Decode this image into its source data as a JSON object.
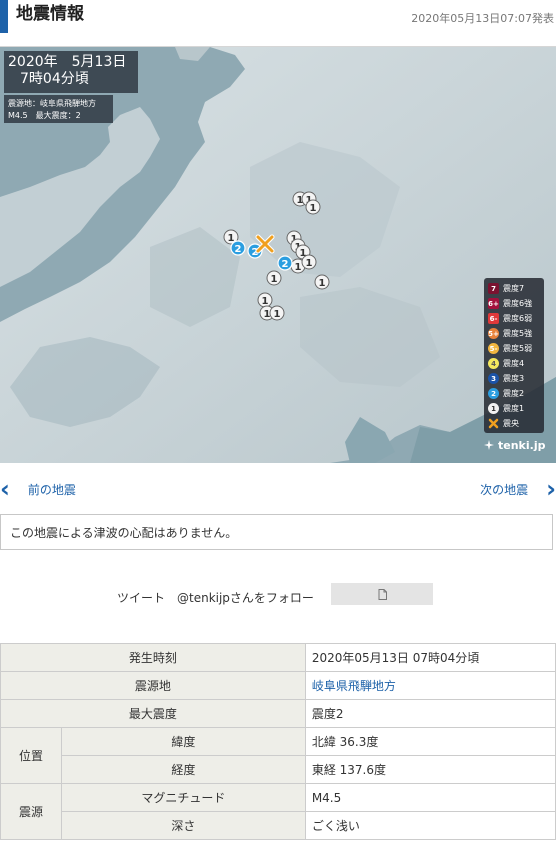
{
  "header": {
    "title": "地震情報",
    "time": "2020年05月13日07:07発表"
  },
  "map": {
    "date_line1": "2020年　5月13日",
    "date_line2": "7時04分頃",
    "epicenter_line": "震源地：岐阜県飛騨地方",
    "magnitude_line": "M4.5　最大震度：2",
    "legend": [
      {
        "label": "震度7",
        "mark": "7",
        "color": "#7b1230"
      },
      {
        "label": "震度6強",
        "mark": "6+",
        "color": "#a3103c"
      },
      {
        "label": "震度6弱",
        "mark": "6-",
        "color": "#e0393a"
      },
      {
        "label": "震度5強",
        "mark": "5+",
        "color": "#e8823a"
      },
      {
        "label": "震度5弱",
        "mark": "5-",
        "color": "#f1b640"
      },
      {
        "label": "震度4",
        "mark": "4",
        "color": "#f4e85e"
      },
      {
        "label": "震度3",
        "mark": "3",
        "color": "#1b53a8"
      },
      {
        "label": "震度2",
        "mark": "2",
        "color": "#2b9ee0"
      },
      {
        "label": "震度1",
        "mark": "1",
        "color": "#f2f2f2"
      },
      {
        "label": "震央",
        "mark": "x",
        "color": "#f0a020"
      }
    ],
    "brand": "tenki.jp"
  },
  "nav": {
    "prev": "前の地震",
    "next": "次の地震"
  },
  "tsunami": "この地震による津波の心配はありません。",
  "follow": {
    "text": "ツイート　@tenkijpさんをフォロー"
  },
  "table": {
    "occurred_label": "発生時刻",
    "occurred_value": "2020年05月13日 07時04分頃",
    "epicenter_label": "震源地",
    "epicenter_value": "岐阜県飛騨地方",
    "max_label": "最大震度",
    "max_value": "震度2",
    "position_label": "位置",
    "lat_label": "緯度",
    "lat_value": "北緯 36.3度",
    "lon_label": "経度",
    "lon_value": "東経 137.6度",
    "source_label": "震源",
    "mag_label": "マグニチュード",
    "mag_value": "M4.5",
    "depth_label": "深さ",
    "depth_value": "ごく浅い"
  }
}
